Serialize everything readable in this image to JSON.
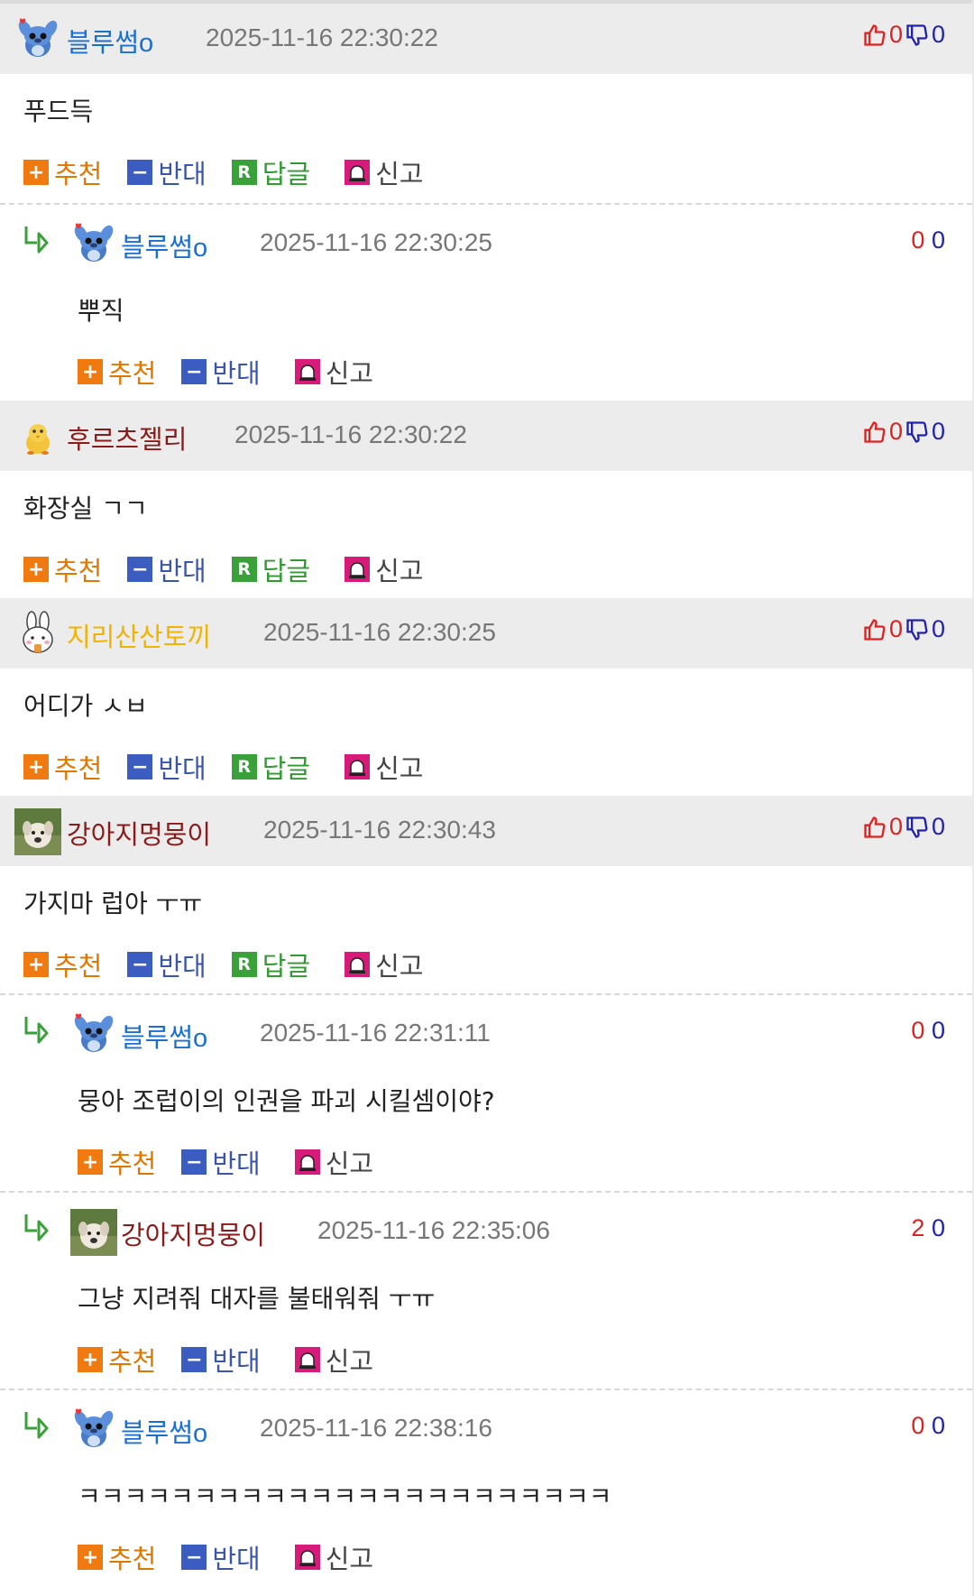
{
  "colors": {
    "nick_blue": "#1a6fd0",
    "nick_red": "#8b1a1a",
    "nick_yellow": "#f0b400",
    "up": "#dd2222",
    "down": "#2222aa"
  },
  "actions": {
    "recommend": "추천",
    "oppose": "반대",
    "reply": "답글",
    "report": "신고"
  },
  "comments": [
    {
      "type": "comment",
      "nick": "블루썸o",
      "nick_color": "#1a6fd0",
      "avatar": "stitch-avatar",
      "date": "2025-11-16 22:30:22",
      "up": "0",
      "down": "0",
      "text": "푸드득"
    },
    {
      "type": "reply",
      "nick": "블루썸o",
      "nick_color": "#1a6fd0",
      "avatar": "stitch-avatar",
      "date": "2025-11-16 22:30:25",
      "up": "0",
      "down": "0",
      "text": "뿌직"
    },
    {
      "type": "comment",
      "nick": "후르츠젤리",
      "nick_color": "#8b1a1a",
      "avatar": "chick-avatar",
      "date": "2025-11-16 22:30:22",
      "up": "0",
      "down": "0",
      "text": "화장실 ㄱㄱ"
    },
    {
      "type": "comment",
      "nick": "지리산산토끼",
      "nick_color": "#f0b400",
      "avatar": "rabbit-avatar",
      "date": "2025-11-16 22:30:25",
      "up": "0",
      "down": "0",
      "text": "어디가 ㅅㅂ"
    },
    {
      "type": "comment",
      "nick": "강아지멍뭉이",
      "nick_color": "#8b1a1a",
      "avatar": "dog-photo-avatar",
      "date": "2025-11-16 22:30:43",
      "up": "0",
      "down": "0",
      "text": "가지마 럽아 ㅜㅠ"
    },
    {
      "type": "reply",
      "nick": "블루썸o",
      "nick_color": "#1a6fd0",
      "avatar": "stitch-avatar",
      "date": "2025-11-16 22:31:11",
      "up": "0",
      "down": "0",
      "text": "뭉아 조럽이의 인권을 파괴 시킬셈이야?"
    },
    {
      "type": "reply",
      "nick": "강아지멍뭉이",
      "nick_color": "#8b1a1a",
      "avatar": "dog-photo-avatar",
      "date": "2025-11-16 22:35:06",
      "up": "2",
      "down": "0",
      "text": "그냥 지려줘 대자를 불태워줘 ㅜㅠ"
    },
    {
      "type": "reply",
      "nick": "블루썸o",
      "nick_color": "#1a6fd0",
      "avatar": "stitch-avatar",
      "date": "2025-11-16 22:38:16",
      "up": "0",
      "down": "0",
      "text": "ㅋㅋㅋㅋㅋㅋㅋㅋㅋㅋㅋㅋㅋㅋㅋㅋㅋㅋㅋㅋㅋㅋㅋ"
    }
  ]
}
